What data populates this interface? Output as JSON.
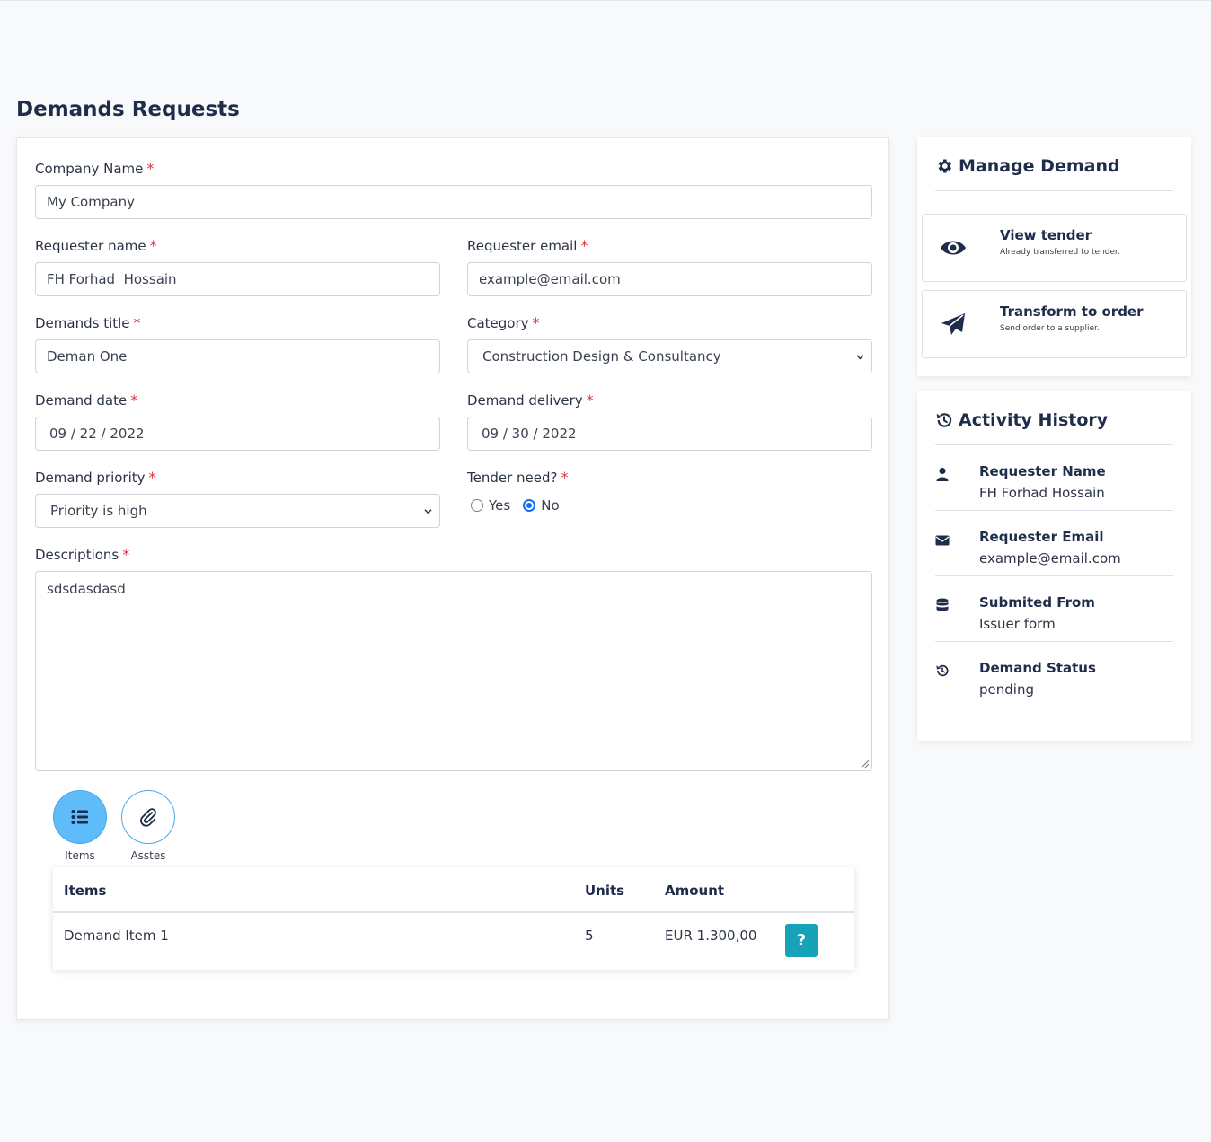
{
  "page": {
    "title": "Demands Requests"
  },
  "form": {
    "required_mark": "*",
    "company_name": {
      "label": "Company Name",
      "value": "My Company"
    },
    "requester_name": {
      "label": "Requester name",
      "value": "FH Forhad  Hossain"
    },
    "requester_email": {
      "label": "Requester email",
      "value": "example@email.com"
    },
    "demands_title": {
      "label": "Demands title",
      "value": "Deman One"
    },
    "category": {
      "label": "Category",
      "value": "Construction Design & Consultancy"
    },
    "demand_date": {
      "label": "Demand date",
      "value": "09 / 22 / 2022"
    },
    "demand_delivery": {
      "label": "Demand delivery",
      "value": "09 / 30 / 2022"
    },
    "demand_priority": {
      "label": "Demand priority",
      "value": "Priority is high"
    },
    "tender_need": {
      "label": "Tender need?",
      "options": [
        "Yes",
        "No"
      ],
      "selected": "No"
    },
    "descriptions": {
      "label": "Descriptions",
      "value": "sdsdasdasd"
    }
  },
  "tabs": [
    {
      "label": "Items",
      "icon": "list-icon",
      "active": true
    },
    {
      "label": "Asstes",
      "icon": "paperclip-icon",
      "active": false
    }
  ],
  "items_table": {
    "headers": [
      "Items",
      "Units",
      "Amount"
    ],
    "rows": [
      {
        "item": "Demand Item 1",
        "units": "5",
        "amount": "EUR 1.300,00",
        "action": "?"
      }
    ]
  },
  "manage_demand": {
    "title": "Manage Demand",
    "icon": "gear-icon",
    "actions": [
      {
        "title": "View tender",
        "subtitle": "Already transferred to tender.",
        "icon": "eye-icon"
      },
      {
        "title": "Transform to order",
        "subtitle": "Send order to a supplier.",
        "icon": "paper-plane-icon"
      }
    ]
  },
  "activity_history": {
    "title": "Activity History",
    "icon": "history-icon",
    "entries": [
      {
        "title": "Requester Name",
        "value": "FH Forhad Hossain",
        "icon": "user-icon"
      },
      {
        "title": "Requester Email",
        "value": "example@email.com",
        "icon": "envelope-icon"
      },
      {
        "title": "Submited From",
        "value": "Issuer form",
        "icon": "database-icon"
      },
      {
        "title": "Demand Status",
        "value": "pending",
        "icon": "history-icon"
      }
    ]
  },
  "colors": {
    "primary_text": "#1f2d4a",
    "required": "#dc3545",
    "radio_checked": "#0d6efd",
    "active_tab": "#5dbcf9",
    "help_button": "#17a2b8"
  }
}
